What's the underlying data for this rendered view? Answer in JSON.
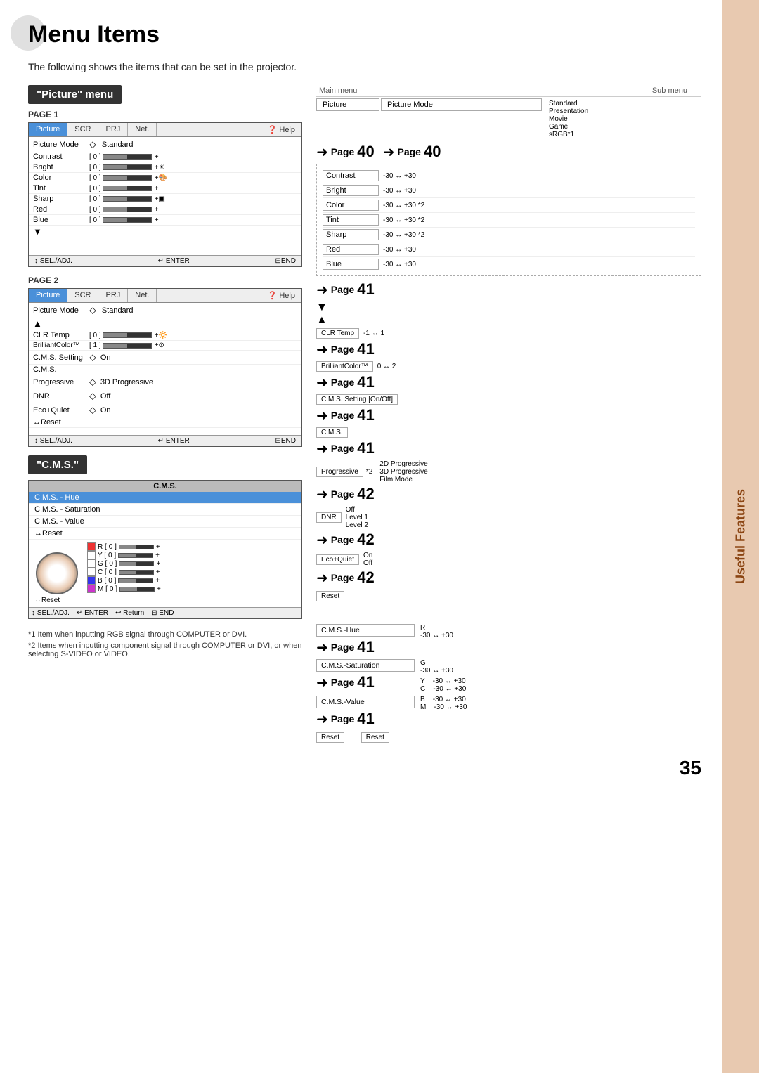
{
  "page": {
    "title": "Menu Items",
    "intro": "The following shows the items that can be set in the projector.",
    "page_number": "35",
    "right_tab": "Useful Features"
  },
  "picture_menu": {
    "header": "\"Picture\" menu",
    "page1_label": "PAGE 1",
    "page2_label": "PAGE 2",
    "tabs": [
      "Picture",
      "SCR",
      "PRJ",
      "Net.",
      "Help"
    ],
    "active_tab": "Picture",
    "picture_mode_label": "Picture Mode",
    "picture_mode_value": "Standard",
    "page1_rows": [
      {
        "label": "Contrast",
        "value": "0",
        "has_bar": true
      },
      {
        "label": "Bright",
        "value": "0",
        "has_bar": true
      },
      {
        "label": "Color",
        "value": "0",
        "has_bar": true
      },
      {
        "label": "Tint",
        "value": "0",
        "has_bar": true
      },
      {
        "label": "Sharp",
        "value": "0",
        "has_bar": true
      },
      {
        "label": "Red",
        "value": "0",
        "has_bar": true
      },
      {
        "label": "Blue",
        "value": "0",
        "has_bar": true
      }
    ],
    "footer1": [
      "↕ SEL./ADJ.",
      "↵ ENTER",
      "⊟END"
    ],
    "page2_rows": [
      {
        "label": "CLR Temp",
        "value": "0",
        "has_bar": true
      },
      {
        "label": "BrilliantColor™",
        "value": "1",
        "has_bar": true
      },
      {
        "label": "C.M.S. Setting",
        "value": "On",
        "has_icon": true
      },
      {
        "label": "C.M.S.",
        "value": ""
      },
      {
        "label": "Progressive",
        "value": "3D Progressive",
        "has_icon": true
      },
      {
        "label": "DNR",
        "value": "Off",
        "has_icon": true
      },
      {
        "label": "Eco+Quiet",
        "value": "On",
        "has_icon": true
      },
      {
        "label": "↔Reset",
        "value": ""
      }
    ],
    "footer2": [
      "↕ SEL./ADJ.",
      "↵ ENTER",
      "⊟END"
    ]
  },
  "cms_menu": {
    "header": "\"C.M.S.\"",
    "panel_title": "C.M.S.",
    "items": [
      "C.M.S. - Hue",
      "C.M.S. - Saturation",
      "C.M.S. - Value",
      "↔Reset"
    ],
    "active_item": "C.M.S. - Hue",
    "color_rows": [
      {
        "color": "#ff0000",
        "label": "R",
        "value": "0"
      },
      {
        "color": "#ffff00",
        "label": "Y",
        "value": "0"
      },
      {
        "color": "#00aa00",
        "label": "G",
        "value": "0"
      },
      {
        "color": "#00aaaa",
        "label": "C",
        "value": "0"
      },
      {
        "color": "#0000ff",
        "label": "B",
        "value": "0"
      },
      {
        "color": "#cc00cc",
        "label": "M",
        "value": "0"
      }
    ],
    "footer": [
      "↕ SEL./ADJ.",
      "↵ ENTER",
      "⊟ END",
      "↩ Return"
    ]
  },
  "right_col": {
    "main_menu_label": "Main menu",
    "sub_menu_label": "Sub menu",
    "picture_label": "Picture",
    "picture_mode_label": "Picture Mode",
    "page40_arrow": "➜Page 40",
    "page40_num": "40",
    "submenu_options": [
      "Standard",
      "Presentation",
      "Movie",
      "Game",
      "sRGB*1"
    ],
    "rows": [
      {
        "label": "Contrast",
        "range": "-30 ↔ +30",
        "page": "40"
      },
      {
        "label": "Bright",
        "range": "-30 ↔ +30",
        "page": "40",
        "note": ""
      },
      {
        "label": "Color",
        "range": "-30 ↔ +30",
        "page": "40",
        "note": "*2"
      },
      {
        "label": "Tint",
        "range": "-30 ↔ +30",
        "page": "41",
        "note": "*2"
      },
      {
        "label": "Sharp",
        "range": "-30 ↔ +30",
        "page": "41",
        "note": "*2"
      },
      {
        "label": "Red",
        "range": "-30 ↔ +30",
        "page": "41"
      },
      {
        "label": "Blue",
        "range": "-30 ↔ +30",
        "page": "41"
      }
    ],
    "page41_first": "41",
    "clr_temp_label": "CLR Temp",
    "clr_temp_range": "-1 ↔ 1",
    "page41_clr": "41",
    "brilliantcolor_label": "BrilliantColor™",
    "brilliantcolor_range": "0 ↔ 2",
    "page41_bc": "41",
    "cms_setting_label": "C.M.S. Setting [On/Off]",
    "page41_cms": "41",
    "cms_label": "C.M.S.",
    "page41_cms2": "41",
    "progressive_label": "Progressive",
    "progressive_note": "*2",
    "progressive_options": [
      "2D Progressive",
      "3D Progressive",
      "Film Mode"
    ],
    "page42_prog": "42",
    "dnr_label": "DNR",
    "dnr_options": [
      "Off",
      "Level 1",
      "Level 2"
    ],
    "page42_dnr": "42",
    "ecoquiet_label": "Eco+Quiet",
    "ecoquiet_options": [
      "On",
      "Off"
    ],
    "page42_eco": "42",
    "reset_label": "Reset",
    "cms_hue_label": "C.M.S.-Hue",
    "page41_hue": "41",
    "hue_rows": [
      {
        "label": "R",
        "range": "-30 ↔ +30"
      },
      {
        "label": "Y",
        "range": "-30 ↔ +30"
      },
      {
        "label": "G",
        "range": "-30 ↔ +30"
      },
      {
        "label": "C",
        "range": "-30 ↔ +30"
      },
      {
        "label": "B",
        "range": "-30 ↔ +30"
      },
      {
        "label": "M",
        "range": "-30 ↔ +30"
      }
    ],
    "cms_saturation_label": "C.M.S.-Saturation",
    "page41_sat": "41",
    "cms_value_label": "C.M.S.-Value",
    "page41_val": "41",
    "reset_label2": "Reset",
    "reset_label3": "Reset"
  },
  "footnotes": [
    "*1  Item when inputting RGB signal through COMPUTER or DVI.",
    "*2  Items when inputting component signal through COMPUTER or DVI, or when selecting S-VIDEO or VIDEO."
  ]
}
